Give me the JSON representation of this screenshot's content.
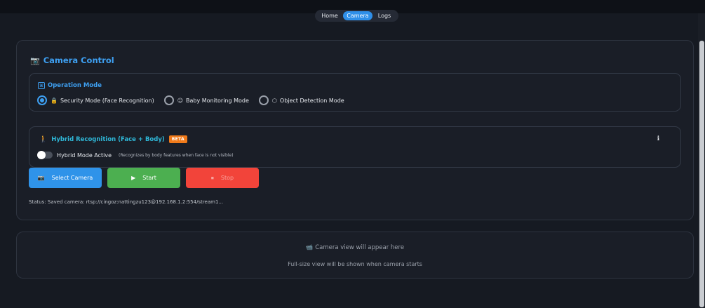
{
  "nav": {
    "tabs": [
      {
        "label": "Home",
        "active": false
      },
      {
        "label": "Camera",
        "active": true
      },
      {
        "label": "Logs",
        "active": false
      }
    ]
  },
  "camera_panel": {
    "icon": "camera-icon",
    "title": "Camera Control",
    "operation_mode": {
      "icon": "mode-icon",
      "title": "Operation Mode",
      "options": [
        {
          "icon": "lock-icon",
          "label": "Security Mode (Face Recognition)",
          "selected": true
        },
        {
          "icon": "baby-icon",
          "label": "Baby Monitoring Mode",
          "selected": false
        },
        {
          "icon": "cube-icon",
          "label": "Object Detection Mode",
          "selected": false
        }
      ]
    },
    "hybrid": {
      "icon": "person-icon",
      "title": "Hybrid Recognition (Face + Body)",
      "badge": "BETA",
      "toggle_label": "Hybrid Mode Active",
      "toggle_on": false,
      "toggle_note": "(Recognizes by body features when face is not visible)"
    },
    "buttons": {
      "select_label": "Select Camera",
      "start_label": "Start",
      "stop_label": "Stop"
    },
    "status": "Status: Saved camera: rtsp://cingoz:nattingzu123@192.168.1.2:554/stream1..."
  },
  "camera_view": {
    "placeholder": "Camera view will appear here",
    "hint": "Full-size view will be shown when camera starts"
  },
  "colors": {
    "accent": "#3ea0f2",
    "start": "#4caf50",
    "stop": "#f2443a",
    "beta": "#f07a1a"
  }
}
